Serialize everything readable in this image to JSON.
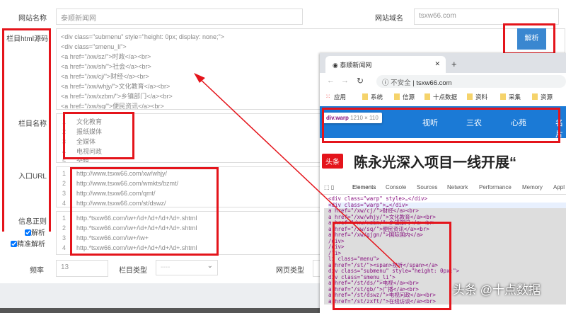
{
  "form": {
    "site_name_label": "网站名称",
    "site_name_value": "泰顺新闻网",
    "domain_label": "网站域名",
    "domain_value": "tsxw66.com",
    "html_label": "栏目html源码",
    "html_lines": [
      "<div class=\"submenu\" style=\"height: 0px; display: none;\">",
      "<div class=\"smenu_li\">",
      "<a href=\"/xw/sz/\">时政</a><br>",
      "<a href=\"/xw/sh/\">社会</a><br>",
      "<a href=\"/xw/cj/\">财经</a><br>",
      "<a href=\"/xw/whjy/\">文化教育</a><br>",
      "<a href=\"/xw/xzbm/\">乡镇部门</a><br>",
      "<a href=\"/xw/sq/\">便民资讯</a><br>"
    ],
    "parse_button": "解析",
    "column_name_label": "栏目名称",
    "column_names": [
      "文化教育",
      "报纸媒体",
      "全媒体",
      "电视问政",
      "全媒"
    ],
    "entry_url_label": "入口URL",
    "entry_urls": [
      "http://www.tsxw66.com/xw/whjy/",
      "http://www.tsxw66.com/wmkts/bzmt/",
      "http://www.tsxw66.com/qmt/",
      "http://www.tsxw66.com/st/dswz/"
    ],
    "regex_label": "信息正则",
    "regexes": [
      "http.*tsxw66.com/\\w+/\\d+/\\d+/\\d+/\\d+.shtml",
      "http.*tsxw66.com/\\w+/\\d+/\\d+/\\d+/\\d+.shtml",
      "http.*tsxw66.com/\\w+/\\w+",
      "http.*tsxw66.com/\\w+/\\d+/\\d+/\\d+/\\d+.shtml"
    ],
    "parse_checkbox": "解析",
    "precise_checkbox": "精准解析",
    "freq_label": "频率",
    "freq_value": "13",
    "column_type_label": "栏目类型",
    "column_type_value": "----",
    "page_type_label": "网页类型"
  },
  "browser": {
    "tab_title": "泰顺新闻网",
    "insecure": "不安全",
    "url": "tsxw66.com",
    "bookmarks": [
      "应用",
      "系统",
      "信源",
      "十点数据",
      "资料",
      "采集",
      "资源"
    ],
    "tooltip_tag": "div.warp",
    "tooltip_size": "1210 × 110",
    "nav_items": [
      "视听",
      "三农",
      "心苑",
      "名片"
    ],
    "headline_badge": "头条",
    "headline": "陈永光深入项目一线开展“",
    "devtools_tabs": [
      "Elements",
      "Console",
      "Sources",
      "Network",
      "Performance",
      "Memory",
      "Appl"
    ],
    "code_lines": [
      "<div class=\"warp\" style>…</div>",
      "<div class=\"warp\">…</div>",
      "a href=\"/xw/cj/\">财经</a><br>",
      "a href=\"/xw/whjy/\">文化教育</a><br>",
      "a href=\"/xw/xzbm/\">乡镇部门</a><br>",
      "a href=\"/xw/sq/\">便民资讯</a><br>",
      "a href=\"/xw/gjgn/\">国际国内</a>",
      "/div>",
      "/div>",
      "/li>",
      "",
      "li class=\"menu\">",
      "a href=\"/st/\"><span>视听</span></a>",
      "div class=\"submenu\" style=\"height: 0px;\">",
      "div class=\"smenu_li\">",
      "a href=\"/st/ds/\">电视</a><br>",
      "a href=\"/st/gb/\">广播</a><br>",
      "a href=\"/st/dswz/\">电视问政</a><br>",
      "a href=\"/st/zxft/\">在线访谈</a><br>"
    ]
  },
  "watermark": "头条 @十点数据",
  "colors": {
    "accent": "#3a87d0",
    "highlight": "#e4141b",
    "nav": "#1b7ad6"
  }
}
